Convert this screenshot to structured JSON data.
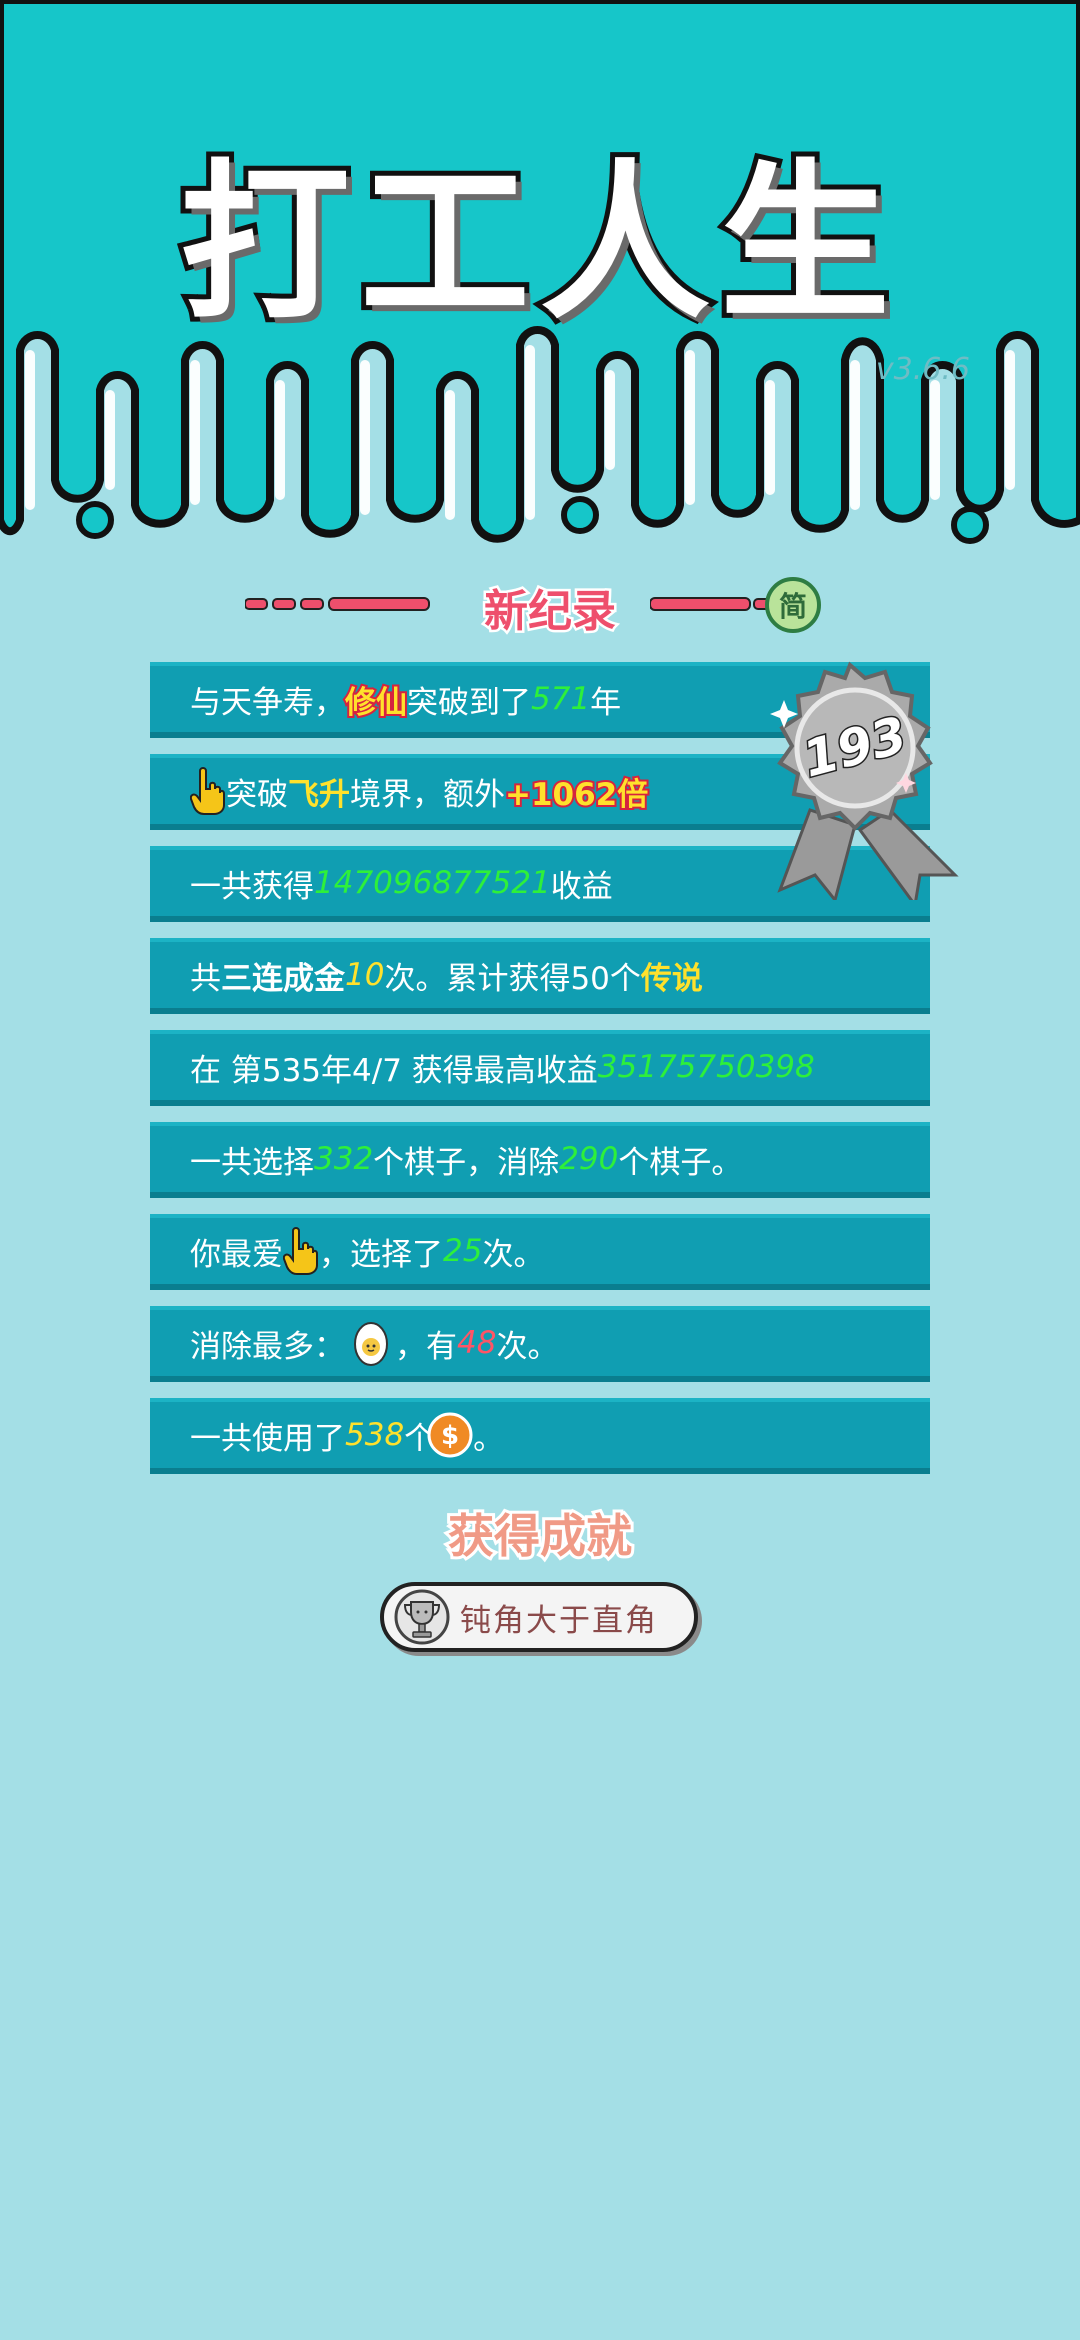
{
  "title": "打工人生",
  "version": "v3.6.6",
  "heading": "新纪录",
  "simplified_badge": "简",
  "medal_number": "193",
  "rows": [
    {
      "pre": "与天争寿，",
      "hl": "修仙",
      "mid": "突破到了",
      "num": "571",
      "post": "年"
    },
    {
      "mid": "突破",
      "hl": "飞升",
      "mid2": "境界，额外",
      "hl2": "+1062倍"
    },
    {
      "pre": "一共获得",
      "num": "147096877521",
      "post": "收益"
    },
    {
      "pre": "共",
      "b1": "三连成金",
      "num": "10",
      "mid": "次。累计获得50个",
      "y": "传说"
    },
    {
      "pre": "在 第535年4/7 获得最高收益",
      "num": "35175750398"
    },
    {
      "pre": "一共选择",
      "num1": "332",
      "mid": "个棋子，消除",
      "num2": "290",
      "post": "个棋子。"
    },
    {
      "pre": "你最爱",
      "mid": "，选择了",
      "num": "25",
      "post": "次。"
    },
    {
      "pre": "消除最多：",
      "mid": "，有",
      "num": "48",
      "post": "次。"
    },
    {
      "pre": "一共使用了",
      "num": "538",
      "mid": "个",
      "post": "。"
    }
  ],
  "achievement_heading": "获得成就",
  "achievement": "钝角大于直角",
  "colors": {
    "teal_top": "#16c6c9",
    "page_bg": "#a4dfe6",
    "row_bg": "#109eb2",
    "green": "#2ef03a",
    "yellow": "#ffe12c"
  },
  "icons": [
    "pointing-hand-icon",
    "egg-icon",
    "coin-icon",
    "trophy-icon",
    "medal-icon"
  ]
}
